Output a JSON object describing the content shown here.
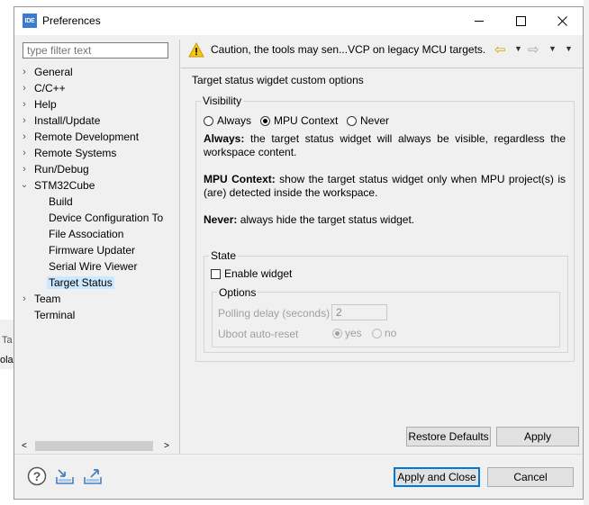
{
  "background": {
    "text_1": "Ta",
    "text_2": "ola"
  },
  "window": {
    "app_icon_text": "IDE",
    "title": "Preferences",
    "controls": {
      "minimize": "minimize-icon",
      "maximize": "maximize-icon",
      "close": "close-icon"
    }
  },
  "filter": {
    "placeholder": "type filter text"
  },
  "tree": {
    "items": [
      {
        "label": "General",
        "expandable": true,
        "level": 0
      },
      {
        "label": "C/C++",
        "expandable": true,
        "level": 0
      },
      {
        "label": "Help",
        "expandable": true,
        "level": 0
      },
      {
        "label": "Install/Update",
        "expandable": true,
        "level": 0
      },
      {
        "label": "Remote Development",
        "expandable": true,
        "level": 0
      },
      {
        "label": "Remote Systems",
        "expandable": true,
        "level": 0
      },
      {
        "label": "Run/Debug",
        "expandable": true,
        "level": 0
      },
      {
        "label": "STM32Cube",
        "expandable": true,
        "expanded": true,
        "level": 0
      },
      {
        "label": "Build",
        "level": 1
      },
      {
        "label": "Device Configuration To",
        "level": 1
      },
      {
        "label": "File Association",
        "level": 1
      },
      {
        "label": "Firmware Updater",
        "level": 1
      },
      {
        "label": "Serial Wire Viewer",
        "level": 1
      },
      {
        "label": "Target Status",
        "level": 1,
        "selected": true
      },
      {
        "label": "Team",
        "expandable": true,
        "level": 0
      },
      {
        "label": "Terminal",
        "level": 0
      }
    ]
  },
  "message": {
    "text": "Caution, the tools may sen...VCP on legacy MCU targets.",
    "icon": "warning-icon"
  },
  "page": {
    "title": "Target status wigdet custom options",
    "visibility": {
      "label": "Visibility",
      "options": [
        "Always",
        "MPU Context",
        "Never"
      ],
      "selected": "MPU Context",
      "always_bold": "Always:",
      "always_text": " the target status widget will always be visible, regardless the workspace content.",
      "mpu_bold": "MPU Context:",
      "mpu_text": " show the target status widget only when MPU project(s) is (are) detected inside the workspace.",
      "never_bold": "Never:",
      "never_text": " always hide the target status widget."
    },
    "state": {
      "label": "State",
      "enable_label": "Enable widget",
      "enabled": false,
      "options_label": "Options",
      "polling_label": "Polling delay (seconds)",
      "polling_value": "2",
      "uboot_label": "Uboot auto-reset",
      "uboot_options": [
        "yes",
        "no"
      ],
      "uboot_selected": "yes"
    }
  },
  "buttons": {
    "restore_defaults": "Restore Defaults",
    "apply": "Apply",
    "apply_and_close": "Apply and Close",
    "cancel": "Cancel"
  },
  "footer_icons": [
    "help-icon",
    "import-icon",
    "export-icon"
  ],
  "colors": {
    "selection": "#cce8ff",
    "accent": "#0078d7",
    "warning": "#f2c811"
  }
}
